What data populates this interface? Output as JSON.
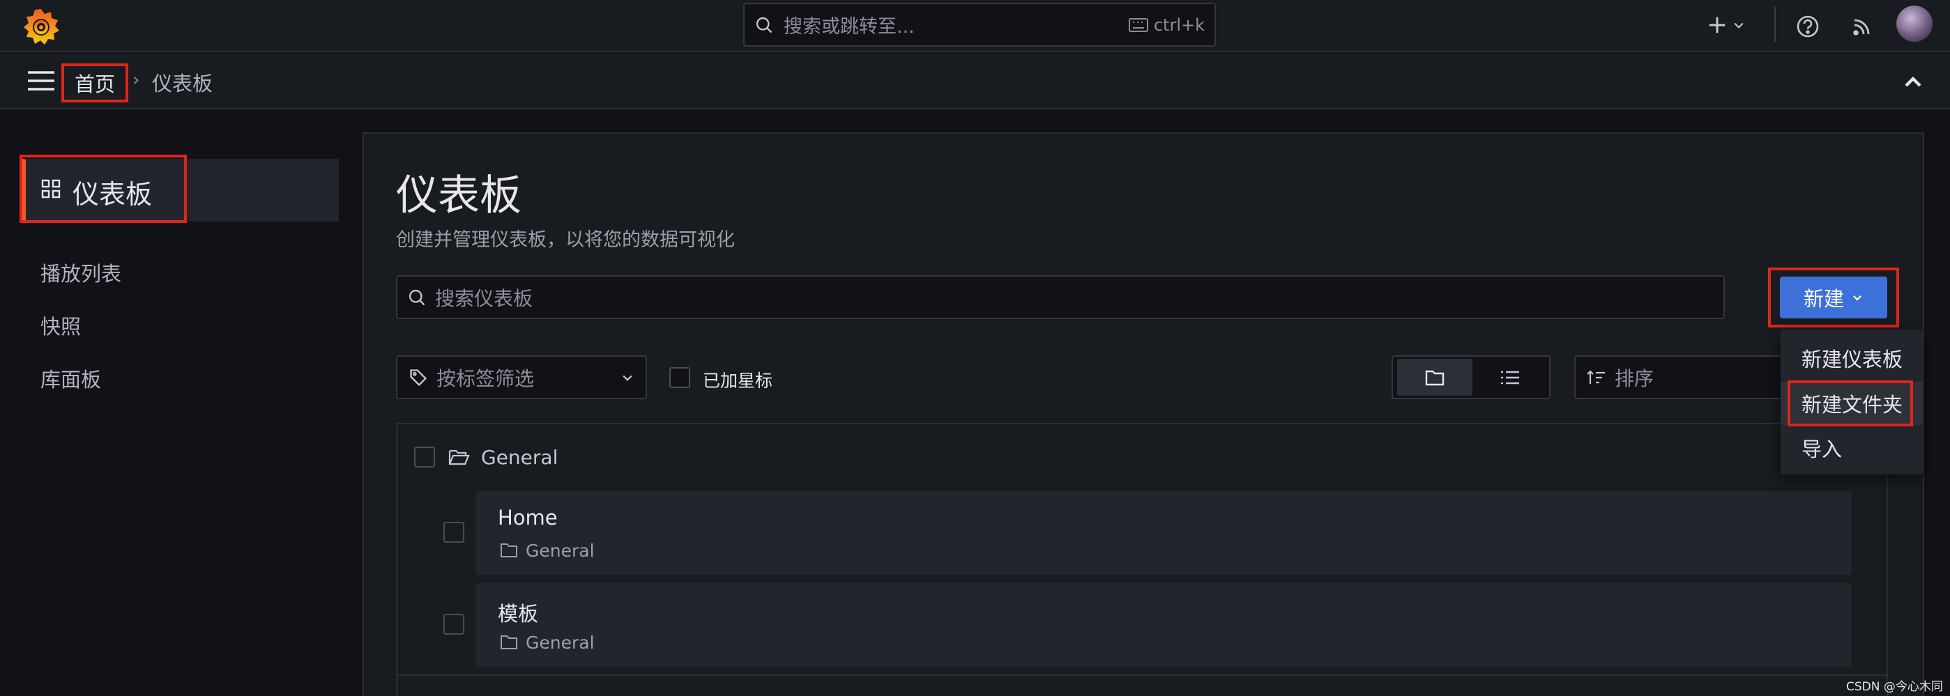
{
  "topbar": {
    "search_placeholder": "搜索或跳转至...",
    "shortcut": "ctrl+k",
    "plus_icon": "plus-icon",
    "help_icon": "help-icon",
    "news_icon": "rss-icon"
  },
  "breadcrumb": {
    "home": "首页",
    "separator": "›",
    "current": "仪表板"
  },
  "sidebar": {
    "active": {
      "label": "仪表板",
      "icon": "apps-icon"
    },
    "items": [
      {
        "label": "播放列表"
      },
      {
        "label": "快照"
      },
      {
        "label": "库面板"
      }
    ]
  },
  "main": {
    "title": "仪表板",
    "subtitle": "创建并管理仪表板，以将您的数据可视化",
    "search_placeholder": "搜索仪表板",
    "new_button": "新建",
    "tag_filter_placeholder": "按标签筛选",
    "starred_label": "已加星标",
    "sort_placeholder": "排序"
  },
  "list": {
    "folder": {
      "name": "General"
    },
    "rows": [
      {
        "title": "Home",
        "folder": "General"
      },
      {
        "title": "模板",
        "folder": "General"
      }
    ]
  },
  "new_menu": {
    "items": [
      "新建仪表板",
      "新建文件夹",
      "导入"
    ]
  },
  "watermark": "CSDN @今心木同",
  "colors": {
    "accent": "#f05a28",
    "primary_button": "#3d71d9",
    "highlight_box": "#e0251c"
  }
}
